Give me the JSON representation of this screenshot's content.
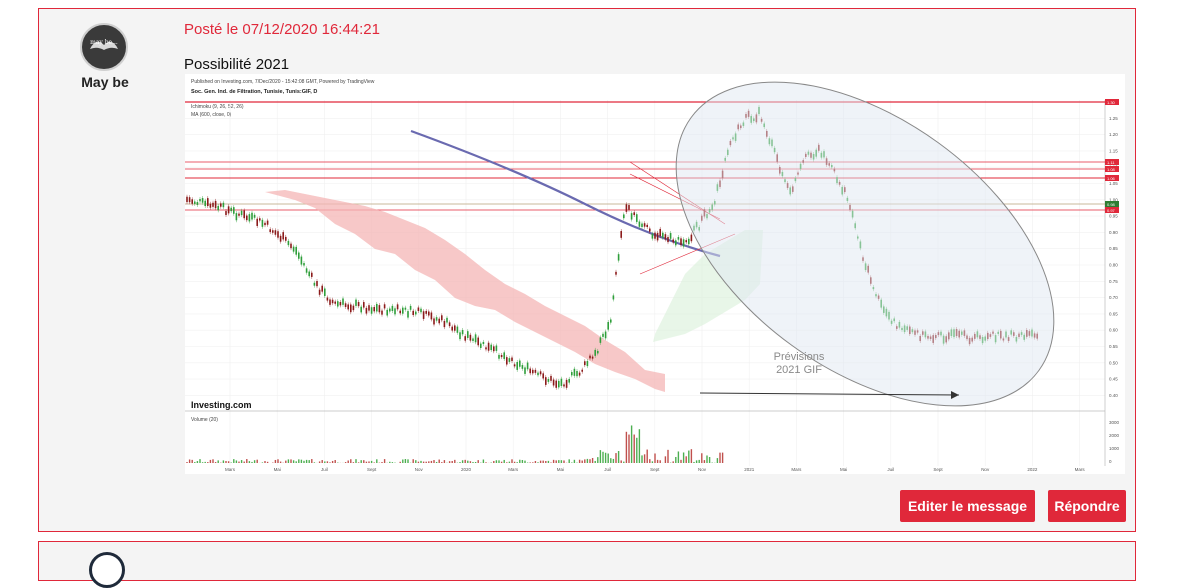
{
  "post": {
    "author": "May be",
    "avatar_text": "may be...",
    "posted_label": "Posté le 07/12/2020 16:44:21",
    "message": "Possibilité 2021"
  },
  "chart": {
    "published": "Published on Investing.com, 7/Dec/2020 - 15:42:08 GMT, Powered by TradingView",
    "symbol": "Soc. Gen. Ind. de Filtration, Tunisie, Tunis:GIF, D",
    "indicator1": "Ichimoku (9, 26, 52, 26)",
    "indicator2": "MA (600, close, 0)",
    "volume_label": "Volume (20)",
    "logo": "Investing.com",
    "forecast_line1": "Prévisions",
    "forecast_line2": "2021 GIF",
    "price_ticks": [
      "1.30",
      "1.25",
      "1.20",
      "1.15",
      "1.10",
      "1.05",
      "1.00",
      "0.95",
      "0.90",
      "0.85",
      "0.80",
      "0.75",
      "0.70",
      "0.65",
      "0.60",
      "0.55",
      "0.50",
      "0.45",
      "0.40"
    ],
    "volume_ticks": [
      "3000",
      "2000",
      "1000",
      "0"
    ],
    "time_ticks": [
      "Mars",
      "Mai",
      "Juil",
      "Sept",
      "Nov",
      "2020",
      "Mars",
      "Mai",
      "Juil",
      "Sept",
      "Nov",
      "2021",
      "Mars",
      "Mai",
      "Juil",
      "Sept",
      "Nov",
      "2022",
      "Mars"
    ],
    "price_tags": [
      "1.30",
      "1.11",
      "1.08",
      "1.06",
      "0.98",
      "0.97"
    ],
    "colors": {
      "up": "#2e9e3a",
      "down": "#8b1a1a",
      "cloud": "#f4b6b6",
      "ma": "#6a6ab0",
      "resistance": "#e0283a"
    }
  },
  "buttons": {
    "edit": "Editer le message",
    "reply": "Répondre"
  }
}
